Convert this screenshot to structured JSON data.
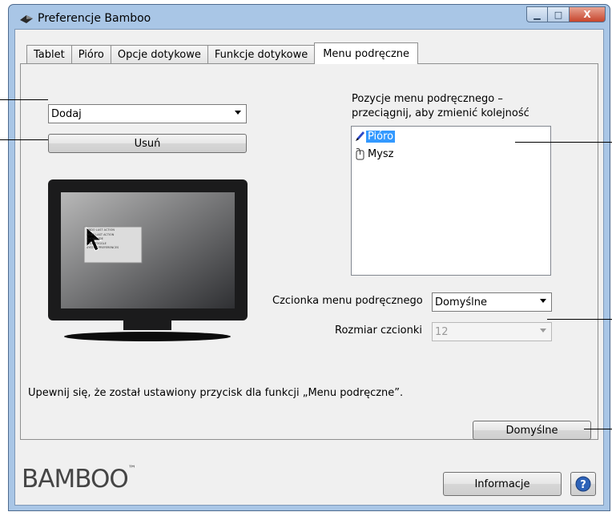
{
  "window": {
    "title": "Preferencje Bamboo",
    "caption_minimize": "▁",
    "caption_maximize": "□",
    "caption_close": "X"
  },
  "tabs": [
    {
      "label": "Tablet"
    },
    {
      "label": "Pióro"
    },
    {
      "label": "Opcje dotykowe"
    },
    {
      "label": "Funkcje dotykowe"
    },
    {
      "label": "Menu podręczne",
      "active": true
    }
  ],
  "left": {
    "action_select_value": "Dodaj",
    "delete_button": "Usuń"
  },
  "preview_menu": {
    "lines": [
      "UNDO LAST ACTION",
      "REDO LAST ACTION",
      "SHOW/HIDE",
      "CALC TOGGLE",
      "SYSTEM PREFERENCES"
    ]
  },
  "right": {
    "list_heading_line1": "Pozycje menu podręcznego –",
    "list_heading_line2": "przeciągnij, aby zmienić kolejność",
    "items": [
      {
        "label": "Pióro",
        "icon": "pen-icon",
        "selected": true
      },
      {
        "label": "Mysz",
        "icon": "mouse-icon",
        "selected": false
      }
    ],
    "font_label": "Czcionka menu podręcznego",
    "font_value": "Domyślne",
    "size_label": "Rozmiar czcionki",
    "size_value": "12"
  },
  "note": "Upewnij się, że został ustawiony przycisk dla funkcji „Menu podręczne”.",
  "defaults_button": "Domyślne",
  "footer": {
    "logo": "BAMBOO",
    "logo_tm": "™",
    "info_button": "Informacje",
    "help_icon": "help-icon"
  },
  "colors": {
    "selection": "#3399ff",
    "frame": "#a9c6e6",
    "help_button": "#2e63b8"
  }
}
